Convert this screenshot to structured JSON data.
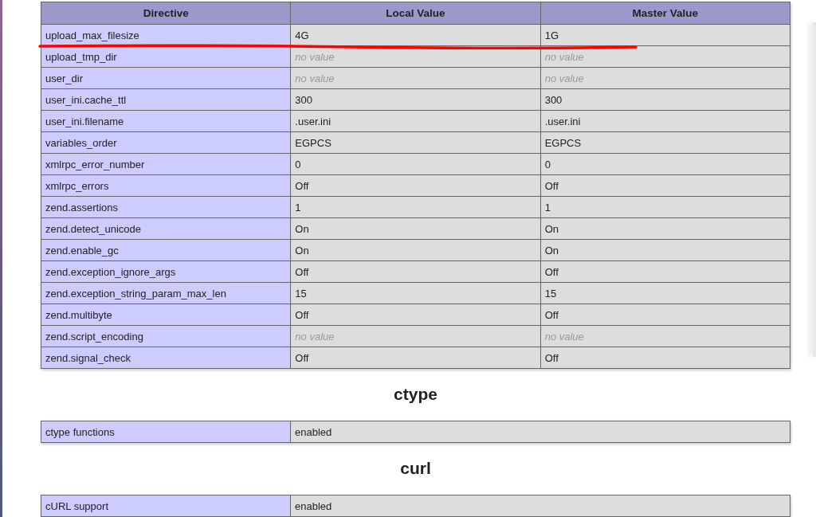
{
  "directives_table": {
    "columns": [
      "Directive",
      "Local Value",
      "Master Value"
    ],
    "rows": [
      {
        "directive": "upload_max_filesize",
        "local": {
          "text": "4G",
          "kind": "value"
        },
        "master": {
          "text": "1G",
          "kind": "value"
        }
      },
      {
        "directive": "upload_tmp_dir",
        "local": {
          "text": "no value",
          "kind": "none"
        },
        "master": {
          "text": "no value",
          "kind": "none"
        }
      },
      {
        "directive": "user_dir",
        "local": {
          "text": "no value",
          "kind": "none"
        },
        "master": {
          "text": "no value",
          "kind": "none"
        }
      },
      {
        "directive": "user_ini.cache_ttl",
        "local": {
          "text": "300",
          "kind": "value"
        },
        "master": {
          "text": "300",
          "kind": "value"
        }
      },
      {
        "directive": "user_ini.filename",
        "local": {
          "text": ".user.ini",
          "kind": "value"
        },
        "master": {
          "text": ".user.ini",
          "kind": "value"
        }
      },
      {
        "directive": "variables_order",
        "local": {
          "text": "EGPCS",
          "kind": "value"
        },
        "master": {
          "text": "EGPCS",
          "kind": "value"
        }
      },
      {
        "directive": "xmlrpc_error_number",
        "local": {
          "text": "0",
          "kind": "value"
        },
        "master": {
          "text": "0",
          "kind": "value"
        }
      },
      {
        "directive": "xmlrpc_errors",
        "local": {
          "text": "Off",
          "kind": "value"
        },
        "master": {
          "text": "Off",
          "kind": "value"
        }
      },
      {
        "directive": "zend.assertions",
        "local": {
          "text": "1",
          "kind": "value"
        },
        "master": {
          "text": "1",
          "kind": "value"
        }
      },
      {
        "directive": "zend.detect_unicode",
        "local": {
          "text": "On",
          "kind": "value"
        },
        "master": {
          "text": "On",
          "kind": "value"
        }
      },
      {
        "directive": "zend.enable_gc",
        "local": {
          "text": "On",
          "kind": "value"
        },
        "master": {
          "text": "On",
          "kind": "value"
        }
      },
      {
        "directive": "zend.exception_ignore_args",
        "local": {
          "text": "Off",
          "kind": "value"
        },
        "master": {
          "text": "Off",
          "kind": "value"
        }
      },
      {
        "directive": "zend.exception_string_param_max_len",
        "local": {
          "text": "15",
          "kind": "value"
        },
        "master": {
          "text": "15",
          "kind": "value"
        }
      },
      {
        "directive": "zend.multibyte",
        "local": {
          "text": "Off",
          "kind": "value"
        },
        "master": {
          "text": "Off",
          "kind": "value"
        }
      },
      {
        "directive": "zend.script_encoding",
        "local": {
          "text": "no value",
          "kind": "none"
        },
        "master": {
          "text": "no value",
          "kind": "none"
        }
      },
      {
        "directive": "zend.signal_check",
        "local": {
          "text": "Off",
          "kind": "value"
        },
        "master": {
          "text": "Off",
          "kind": "value"
        }
      }
    ]
  },
  "sections": [
    {
      "title": "ctype",
      "rows": [
        {
          "name": "ctype functions",
          "value": "enabled"
        }
      ]
    },
    {
      "title": "curl",
      "rows": [
        {
          "name": "cURL support",
          "value": "enabled"
        }
      ]
    }
  ]
}
